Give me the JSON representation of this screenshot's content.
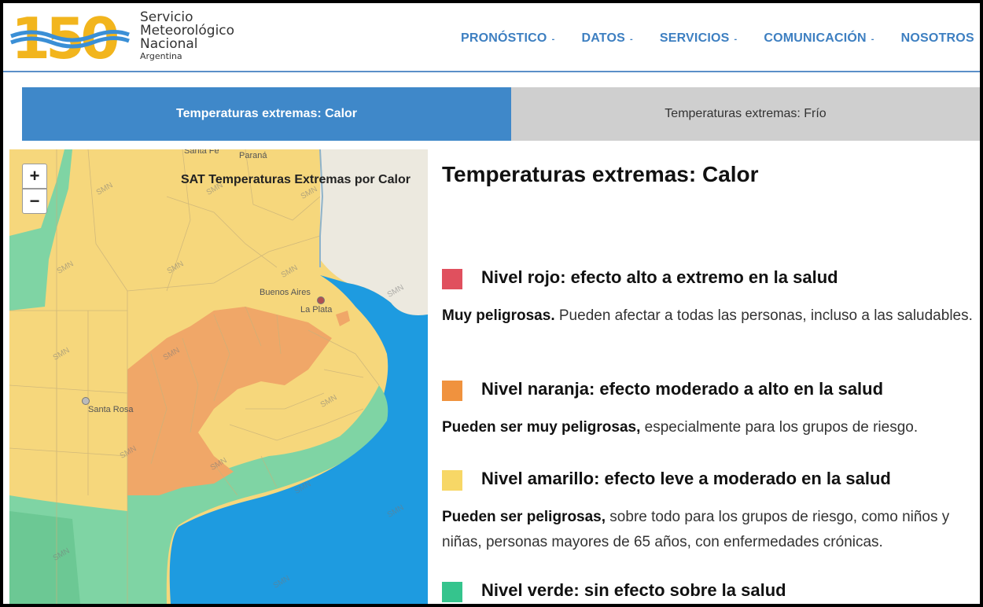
{
  "brand": {
    "logo_number": "150",
    "line1": "Servicio",
    "line2": "Meteorológico",
    "line3": "Nacional",
    "line4": "Argentina"
  },
  "nav": {
    "items": [
      {
        "label": "PRONÓSTICO"
      },
      {
        "label": "DATOS"
      },
      {
        "label": "SERVICIOS"
      },
      {
        "label": "COMUNICACIÓN"
      },
      {
        "label": "NOSOTROS"
      }
    ],
    "caret": "-"
  },
  "tabs": {
    "active": "Temperaturas extremas: Calor",
    "inactive": "Temperaturas extremas: Frío"
  },
  "map": {
    "title": "SAT Temperaturas Extremas por Calor",
    "zoom_in": "+",
    "zoom_out": "−",
    "cities": {
      "santa_fe": "Santa Fe",
      "parana": "Paraná",
      "buenos_aires": "Buenos Aires",
      "la_plata": "La Plata",
      "santa_rosa": "Santa Rosa"
    },
    "watermark": "SMN"
  },
  "info": {
    "title": "Temperaturas extremas: Calor",
    "levels": [
      {
        "color": "#e0505e",
        "heading": "Nivel rojo: efecto alto a extremo en la salud",
        "bold": "Muy peligrosas.",
        "text": " Pueden afectar a todas las personas, incluso a las saludables."
      },
      {
        "color": "#f0923e",
        "heading": "Nivel naranja: efecto moderado a alto en la salud",
        "bold": "Pueden ser muy peligrosas,",
        "text": " especialmente para los grupos de riesgo."
      },
      {
        "color": "#f7d766",
        "heading": "Nivel amarillo: efecto leve a moderado en la salud",
        "bold": "Pueden ser peligrosas,",
        "text": " sobre todo para los grupos de riesgo, como niños y niñas, personas mayores de 65 años, con enfermedades crónicas."
      },
      {
        "color": "#35c48d",
        "heading": "Nivel verde: sin efecto sobre la salud",
        "bold": "",
        "text": ""
      }
    ]
  },
  "colors": {
    "accent": "#3f88c9",
    "map_yellow": "#f6d77c",
    "map_orange": "#f0a768",
    "map_green": "#7fd4a4",
    "sea": "#1e9be0",
    "land_outside": "#ece9df"
  }
}
